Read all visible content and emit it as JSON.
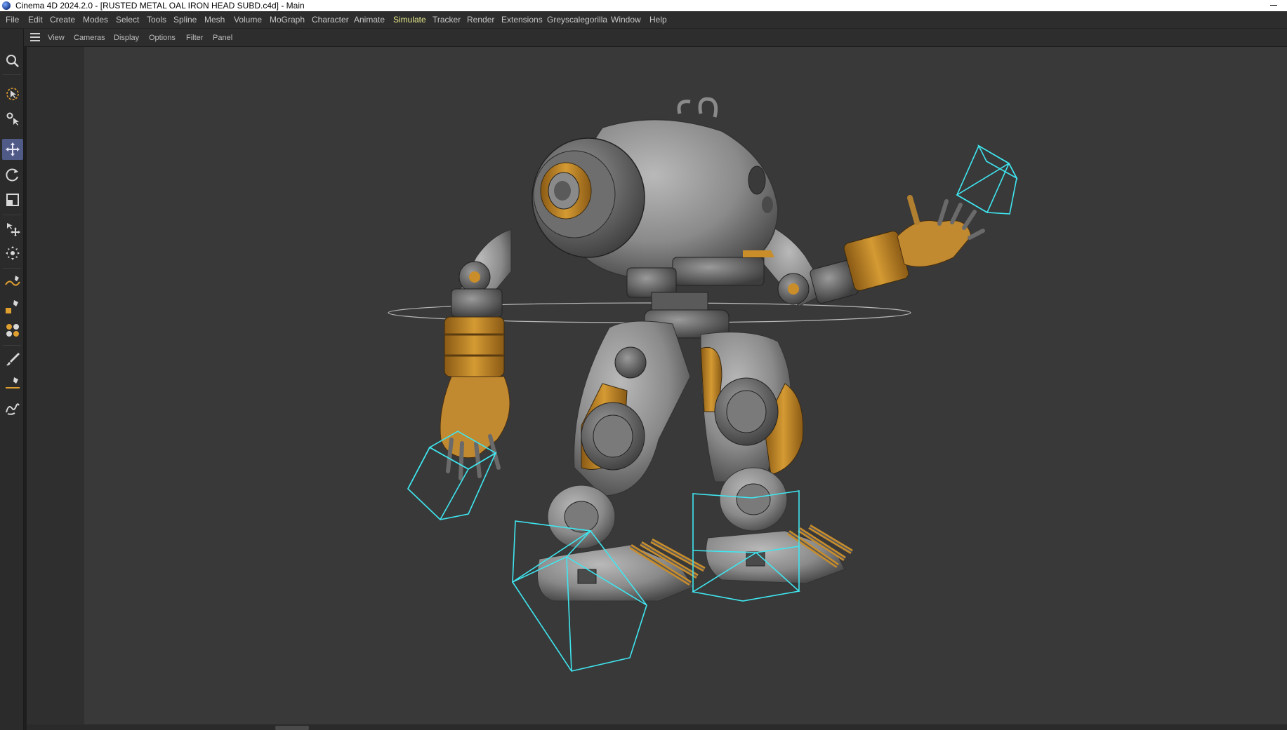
{
  "window": {
    "title": "Cinema 4D 2024.2.0 - [RUSTED METAL OAL IRON HEAD SUBD.c4d] - Main"
  },
  "menubar": {
    "items": [
      "File",
      "Edit",
      "Create",
      "Modes",
      "Select",
      "Tools",
      "Spline",
      "Mesh",
      "Volume",
      "MoGraph",
      "Character",
      "Animate",
      "Simulate",
      "Tracker",
      "Render",
      "Extensions",
      "Greyscalegorilla",
      "Window",
      "Help"
    ],
    "active": "Simulate"
  },
  "viewport_menu": {
    "items": [
      "View",
      "Cameras",
      "Display",
      "Options",
      "Filter",
      "Panel"
    ]
  },
  "tools": [
    {
      "name": "zoom-icon",
      "selected": false
    },
    {
      "name": "live-selection-icon",
      "selected": false
    },
    {
      "name": "tweak-icon",
      "selected": false
    },
    {
      "name": "move-icon",
      "selected": true
    },
    {
      "name": "rotate-icon",
      "selected": false
    },
    {
      "name": "scale-icon",
      "selected": false
    },
    {
      "name": "transfer-icon",
      "selected": false
    },
    {
      "name": "placement-icon",
      "selected": false
    },
    {
      "name": "spline-pen-icon",
      "selected": false
    },
    {
      "name": "primitive-pen-icon",
      "selected": false
    },
    {
      "name": "generator-icon",
      "selected": false
    },
    {
      "name": "brush-icon",
      "selected": false
    },
    {
      "name": "knife-line-icon",
      "selected": false
    },
    {
      "name": "sketch-icon",
      "selected": false
    }
  ],
  "colors": {
    "accent_active": "#e6e88a",
    "selection_box": "#3fe6f0",
    "tool_selected": "#4f5a86",
    "metal": "#8a8a8a",
    "rust_orange": "#c98d2a"
  },
  "scene": {
    "object": "rusted-metal-robot"
  }
}
